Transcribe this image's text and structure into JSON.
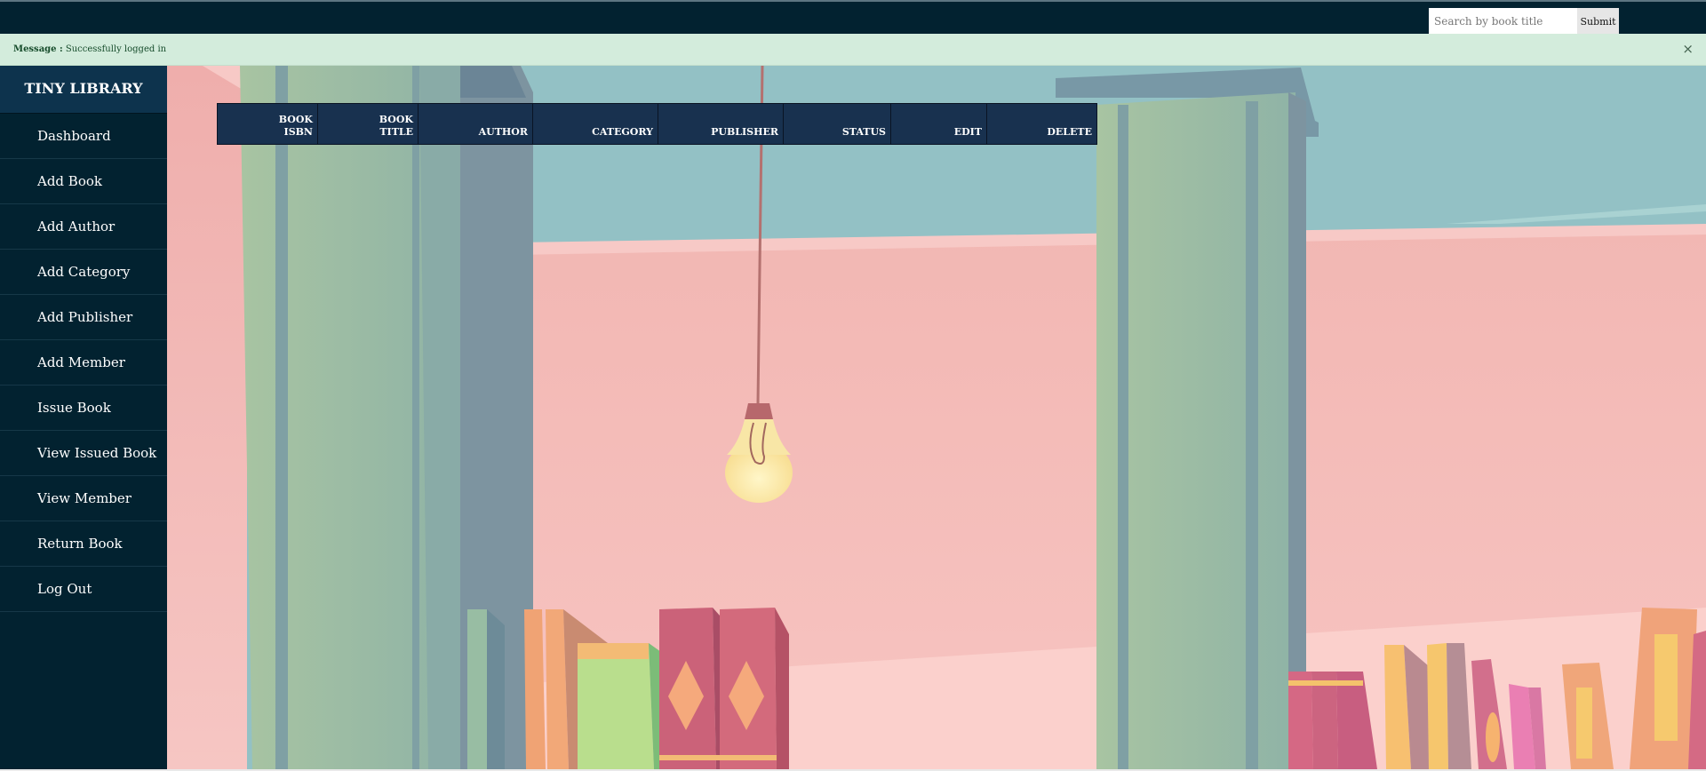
{
  "search": {
    "placeholder": "Search by book title",
    "submit_label": "Submit"
  },
  "alert": {
    "label": "Message :",
    "text": "Successfully logged in",
    "close_glyph": "×"
  },
  "brand": "TINY LIBRARY",
  "nav": [
    "Dashboard",
    "Add Book",
    "Add Author",
    "Add Category",
    "Add Publisher",
    "Add Member",
    "Issue Book",
    "View Issued Book",
    "View Member",
    "Return Book",
    "Log Out"
  ],
  "table": {
    "headers": {
      "isbn": {
        "line1": "BOOK",
        "line2": "ISBN"
      },
      "title": {
        "line1": "BOOK",
        "line2": "TITLE"
      },
      "author": "AUTHOR",
      "category": "CATEGORY",
      "publisher": "PUBLISHER",
      "status": "STATUS",
      "edit": "EDIT",
      "delete": "DELETE"
    }
  },
  "colors": {
    "topbar": "#022230",
    "sidebar": "#022230",
    "alert_bg": "#d3ecdc",
    "table_header": "#18314f",
    "scene_wall": "#f4b8b5",
    "scene_sky": "#93c2c6"
  }
}
